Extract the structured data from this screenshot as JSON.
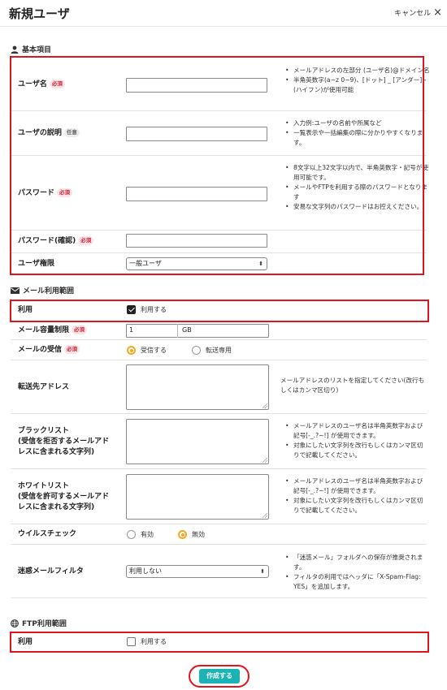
{
  "header": {
    "title": "新規ユーザ",
    "cancel_label": "キャンセル"
  },
  "sections": {
    "basic": {
      "title": "基本項目",
      "icon": "user-icon"
    },
    "mail": {
      "title": "メール利用範囲",
      "icon": "envelope-icon"
    },
    "ftp": {
      "title": "FTP利用範囲",
      "icon": "globe-icon"
    }
  },
  "badges": {
    "required": "必須",
    "optional": "任意"
  },
  "basic": {
    "username": {
      "label": "ユーザ名",
      "value": "",
      "notes": [
        "メールアドレスの左部分 (ユーザ名)@ドメイン名",
        "半角英数字(a~z 0~9)、[ドット] _ [アンダー] - (ハイフン)が使用可能"
      ]
    },
    "description": {
      "label": "ユーザの説明",
      "value": "",
      "notes": [
        "入力例:ユーザの名前や所属など",
        "一覧表示や一括編集の際に分かりやすくなります。"
      ]
    },
    "password": {
      "label": "パスワード",
      "value": "",
      "notes": [
        "8文字以上32文字以内で、半角英数字・記号が使用可能です。",
        "メールやFTPを利用する際のパスワードとなります",
        "安易な文字列のパスワードはお控えください。"
      ]
    },
    "password_confirm": {
      "label": "パスワード(確認)",
      "value": ""
    },
    "role": {
      "label": "ユーザ権限",
      "selected": "一般ユーザ"
    }
  },
  "mail": {
    "use": {
      "label": "利用",
      "option": "利用する",
      "checked": true
    },
    "quota": {
      "label": "メール容量制限",
      "value": "1",
      "unit": "GB"
    },
    "receive": {
      "label": "メールの受信",
      "options": [
        "受信する",
        "転送専用"
      ],
      "selected": "受信する"
    },
    "forward": {
      "label": "転送先アドレス",
      "value": "",
      "note": "メールアドレスのリストを指定してください(改行もしくはカンマ区切り)"
    },
    "blacklist": {
      "label_lines": [
        "ブラックリスト",
        "(受信を拒否するメールアド",
        "レスに含まれる文字列)"
      ],
      "value": "",
      "notes": [
        "メールアドレスのユーザ名は半角英数字および記号[-_.?~!] が使用できます。",
        "対象にしたい文字列を改行もしくはカンマ区切りで記載してください。"
      ]
    },
    "whitelist": {
      "label_lines": [
        "ホワイトリスト",
        "(受信を許可するメールアド",
        "レスに含まれる文字列)"
      ],
      "value": "",
      "notes": [
        "メールアドレスのユーザ名は半角英数字および記号[-_.?~!] が使用できます。",
        "対象にしたい文字列を改行もしくはカンマ区切りで記載してください。"
      ]
    },
    "virus": {
      "label": "ウイルスチェック",
      "options": [
        "有効",
        "無効"
      ],
      "selected": "無効"
    },
    "spam": {
      "label": "迷惑メールフィルタ",
      "selected": "利用しない",
      "notes": [
        "「迷惑メール」フォルダへの保存が推奨されます。",
        "フィルタの利用ではヘッダに「X-Spam-Flag: YES」を追加します。"
      ]
    }
  },
  "ftp": {
    "use": {
      "label": "利用",
      "option": "利用する",
      "checked": false
    }
  },
  "footer": {
    "create_label": "作成する"
  },
  "colors": {
    "highlight_box": "#e0141e",
    "primary_button": "#1bb3b6",
    "radio_selected": "#f5a623",
    "required_badge": "#c8283b"
  }
}
